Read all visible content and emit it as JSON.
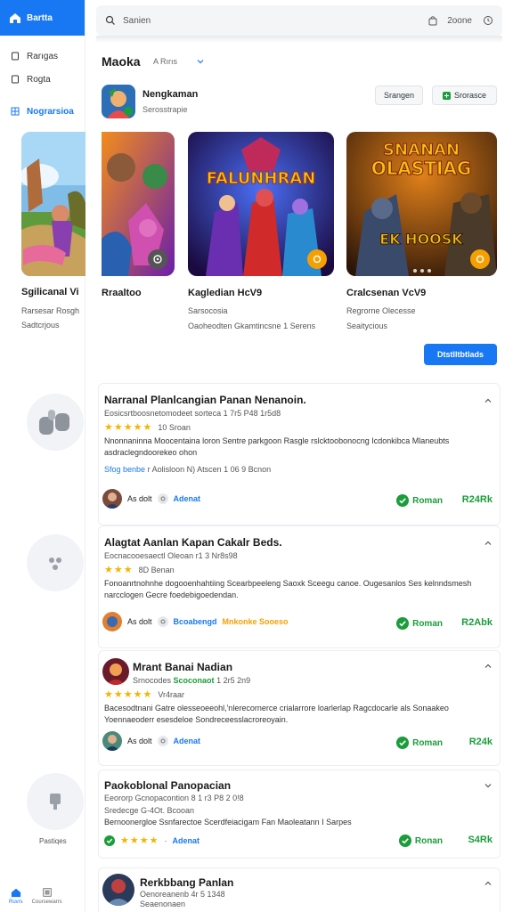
{
  "sidebar": {
    "brand": "Bartta",
    "items": [
      {
        "label": "Rarıgas"
      },
      {
        "label": "Rogta"
      },
      {
        "label": "Nograrsioa"
      }
    ],
    "bottom": [
      {
        "label": "Ruvrs"
      },
      {
        "label": "Coursewarrs"
      }
    ]
  },
  "search": {
    "placeholder": "Sanien",
    "zone": "2oone"
  },
  "header": {
    "title": "Maoka",
    "filter": "A Rırıs"
  },
  "featured": {
    "name": "Nengkaman",
    "sub": "Serosstrapie",
    "btn1": "Srangen",
    "btn2": "Srorasce"
  },
  "peek": {
    "title": "Sgilicanal Vi",
    "sub": "Rarsesar Rosgh",
    "sub2": "Sadtcrjous"
  },
  "carousel": [
    {
      "title": "Rraaltoo",
      "sub": "",
      "sub2": ""
    },
    {
      "title": "Kagledian HcV9",
      "sub": "Sarsocosia",
      "sub2": "Oaoheodten Gkamtincsne 1 Serens"
    },
    {
      "title": "Cralcsenan VcV9",
      "sub": "Regrorne Olecesse",
      "sub2": "Seaitycious"
    }
  ],
  "carousel_art": {
    "game2": "FALUNHRAN",
    "game3a": "SNANAN",
    "game3b": "OLASTIAG",
    "game3c": "EK HOOSK"
  },
  "primary_button": "Dtstlltbtlads",
  "reviews": [
    {
      "title": "Narranal Planlcangian Panan Nenanoin.",
      "meta": "Eosicsrtboosnetomodeet sorteca 1 7r5 P48 1r5d8",
      "stars": "★★★★★",
      "stars_after": "10 Sroan",
      "body": "Nnonnaninna Moocentaina loron Sentre parkgoon Rasgle rslcktoobonocng Icdonkibca Mlaneubts asdraclegndoorekeo ohon",
      "tag1": "Sfog benbe",
      "tags_rest": "r Aolisloon N) Atscen 1 06 9 Bcnon",
      "author": "As dolt",
      "link": "Adenat",
      "verify": "Roman",
      "count": "R24Rk"
    },
    {
      "title": "Alagtat Aanlan Kapan Cakalr Beds.",
      "meta": "Eocnacooesaectl Oleoan r1 3 Nr8s98",
      "stars": "★★★",
      "stars_after": "8D  Benan",
      "body": "Fonoanrtnohnhe dogooenhahtiing Scearbpeeleng Saoxk Sceegu canoe. Ougesanlos Ses kelnndsmesh narcclogen Gecre foedebigoedendan.",
      "author": "As dolt",
      "link": "Bcoabengd",
      "link2": "Mnkonke Sooeso",
      "verify": "Roman",
      "count": "R2Abk"
    },
    {
      "title": "Mrant Banai Nadian",
      "meta_a": "Srnocodes",
      "meta_b": "Scoconaot",
      "meta_c": "1 2r5 2n9",
      "stars": "★★★★★",
      "stars_after": "Vr4raar",
      "body": "Bacesodtnani Gatre olesseoeeohl,'nlerecornerce crialarrore loarlerlap Ragcdocarle als Sonaakeo Yoennaeoderr esesdeloe Sondreceesslacroreoyain.",
      "author": "As dolt",
      "link": "Adenat",
      "verify": "Roman",
      "count": "R24k"
    },
    {
      "title": "Paokoblonal Panopacian",
      "meta": "Eeororp Gcnopacontion 8 1 r3 P8 2 0!8",
      "meta2": "Sredecge G-4Ot.  Bcooan",
      "body": "Bernoonergloe Ssnfarectoe Scerdfeiacigam Fan Maoleatann I Sarpes",
      "side_label": "Pastiqes",
      "stars": "★★★★",
      "link": "Adenat",
      "verify": "Ronan",
      "count": "S4Rk"
    },
    {
      "title": "Rerkbbang Panlan",
      "meta": "Oenoreanenb 4r 5 1348",
      "meta2": "Seaenonaen"
    }
  ]
}
